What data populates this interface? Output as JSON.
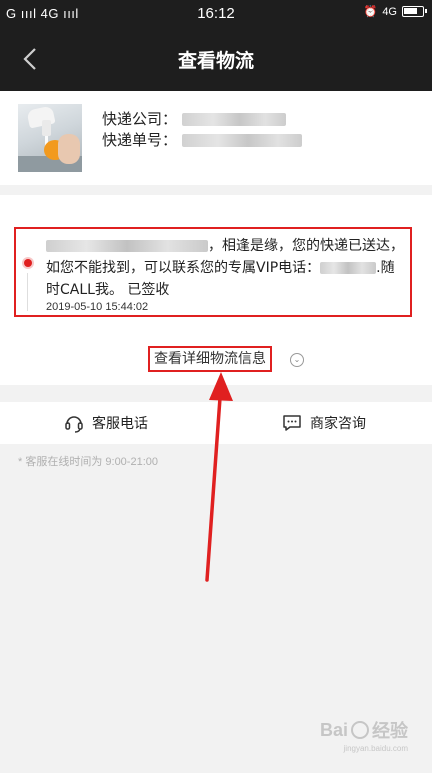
{
  "status_bar": {
    "signal_left": "G",
    "signal_right": "4G",
    "time": "16:12",
    "network": "4G"
  },
  "nav": {
    "title": "查看物流"
  },
  "shipment": {
    "company_label": "快递公司：",
    "tracking_label": "快递单号："
  },
  "tracking": {
    "message_part1": "，相逢是缘，您的快递已送达，如您不能找到，可以联系您的专属VIP电话：",
    "message_part2": ".随时CALL我。 已签收",
    "time": "2019-05-10 15:44:02",
    "detail_link": "查看详细物流信息",
    "expand_icon": "chevron-down-icon"
  },
  "actions": {
    "phone_label": "客服电话",
    "phone_icon": "headset-icon",
    "chat_label": "商家咨询",
    "chat_icon": "chat-bubble-icon"
  },
  "hours_note": "* 客服在线时间为 9:00-21:00",
  "watermark": {
    "brand": "Bai",
    "suffix": "经验",
    "url": "jingyan.baidu.com"
  },
  "colors": {
    "header_bg": "#1e1e1e",
    "highlight_red": "#e02020",
    "page_bg": "#f2f2f2"
  }
}
